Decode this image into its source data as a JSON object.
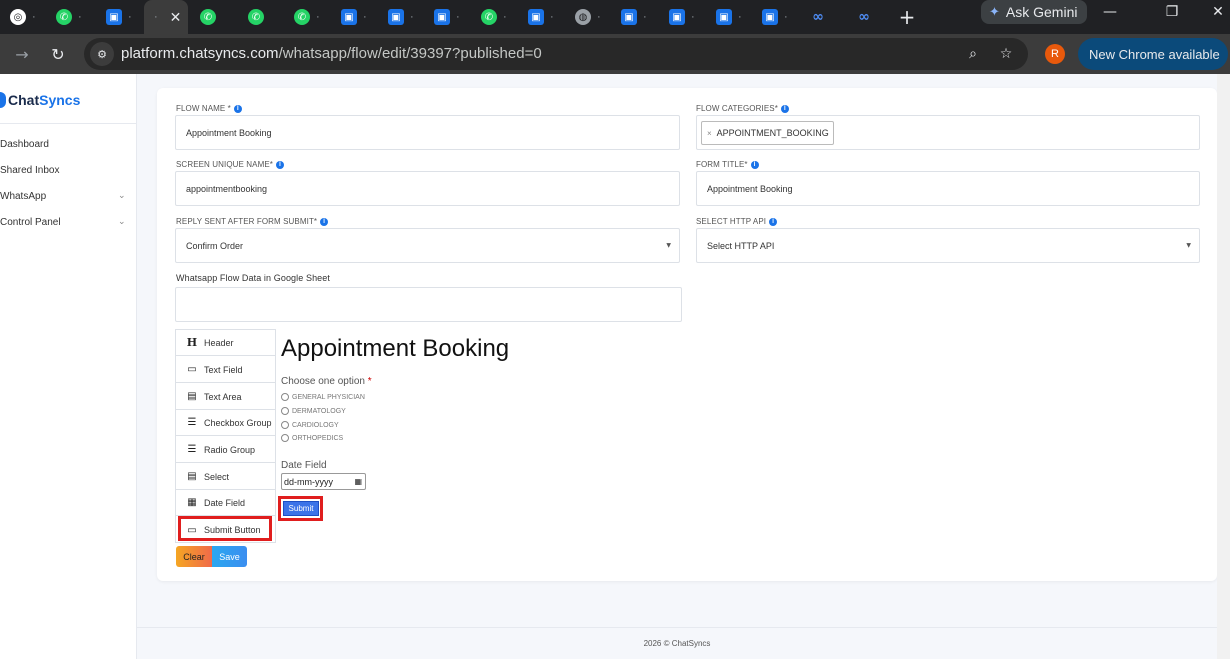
{
  "browser": {
    "active_tab_close": "✕",
    "new_tab": "+",
    "gemini_label": "Ask Gemini",
    "url_host": "platform.chatsyncs.com",
    "url_path": "/whatsapp/flow/edit/39397?published=0",
    "profile_initial": "R",
    "update_label": "New Chrome available"
  },
  "sidebar": {
    "brand_part1": "Chat",
    "brand_part2": "Syncs",
    "items": [
      {
        "label": "Dashboard"
      },
      {
        "label": "Shared Inbox"
      },
      {
        "label": "WhatsApp"
      },
      {
        "label": "Control Panel"
      }
    ]
  },
  "form": {
    "flow_name_label": "FLOW NAME *",
    "flow_name_value": "Appointment Booking",
    "flow_categories_label": "FLOW CATEGORIES*",
    "flow_category_chip": "APPOINTMENT_BOOKING",
    "screen_name_label": "SCREEN UNIQUE NAME*",
    "screen_name_value": "appointmentbooking",
    "form_title_label": "FORM TITLE*",
    "form_title_value": "Appointment Booking",
    "reply_label": "REPLY SENT AFTER FORM SUBMIT*",
    "reply_value": "Confirm Order",
    "http_api_label": "SELECT HTTP API",
    "http_api_value": "Select HTTP API",
    "google_sheet_label": "Whatsapp Flow Data in Google Sheet",
    "google_sheet_value": ""
  },
  "palette": [
    {
      "label": "Header",
      "icon": "H"
    },
    {
      "label": "Text Field",
      "icon": "▭"
    },
    {
      "label": "Text Area",
      "icon": "▤"
    },
    {
      "label": "Checkbox Group",
      "icon": "☰"
    },
    {
      "label": "Radio Group",
      "icon": "☰"
    },
    {
      "label": "Select",
      "icon": "▤"
    },
    {
      "label": "Date Field",
      "icon": "▦"
    },
    {
      "label": "Submit Button",
      "icon": "▭"
    }
  ],
  "actions": {
    "clear": "Clear",
    "save": "Save"
  },
  "preview": {
    "title": "Appointment Booking",
    "question": "Choose one option",
    "required_mark": "*",
    "options": [
      "GENERAL PHYSICIAN",
      "DERMATOLOGY",
      "CARDIOLOGY",
      "ORTHOPEDICS"
    ],
    "date_label": "Date Field",
    "date_placeholder": "dd-mm-yyyy",
    "submit_label": "Submit"
  },
  "footer": "2026 © ChatSyncs"
}
